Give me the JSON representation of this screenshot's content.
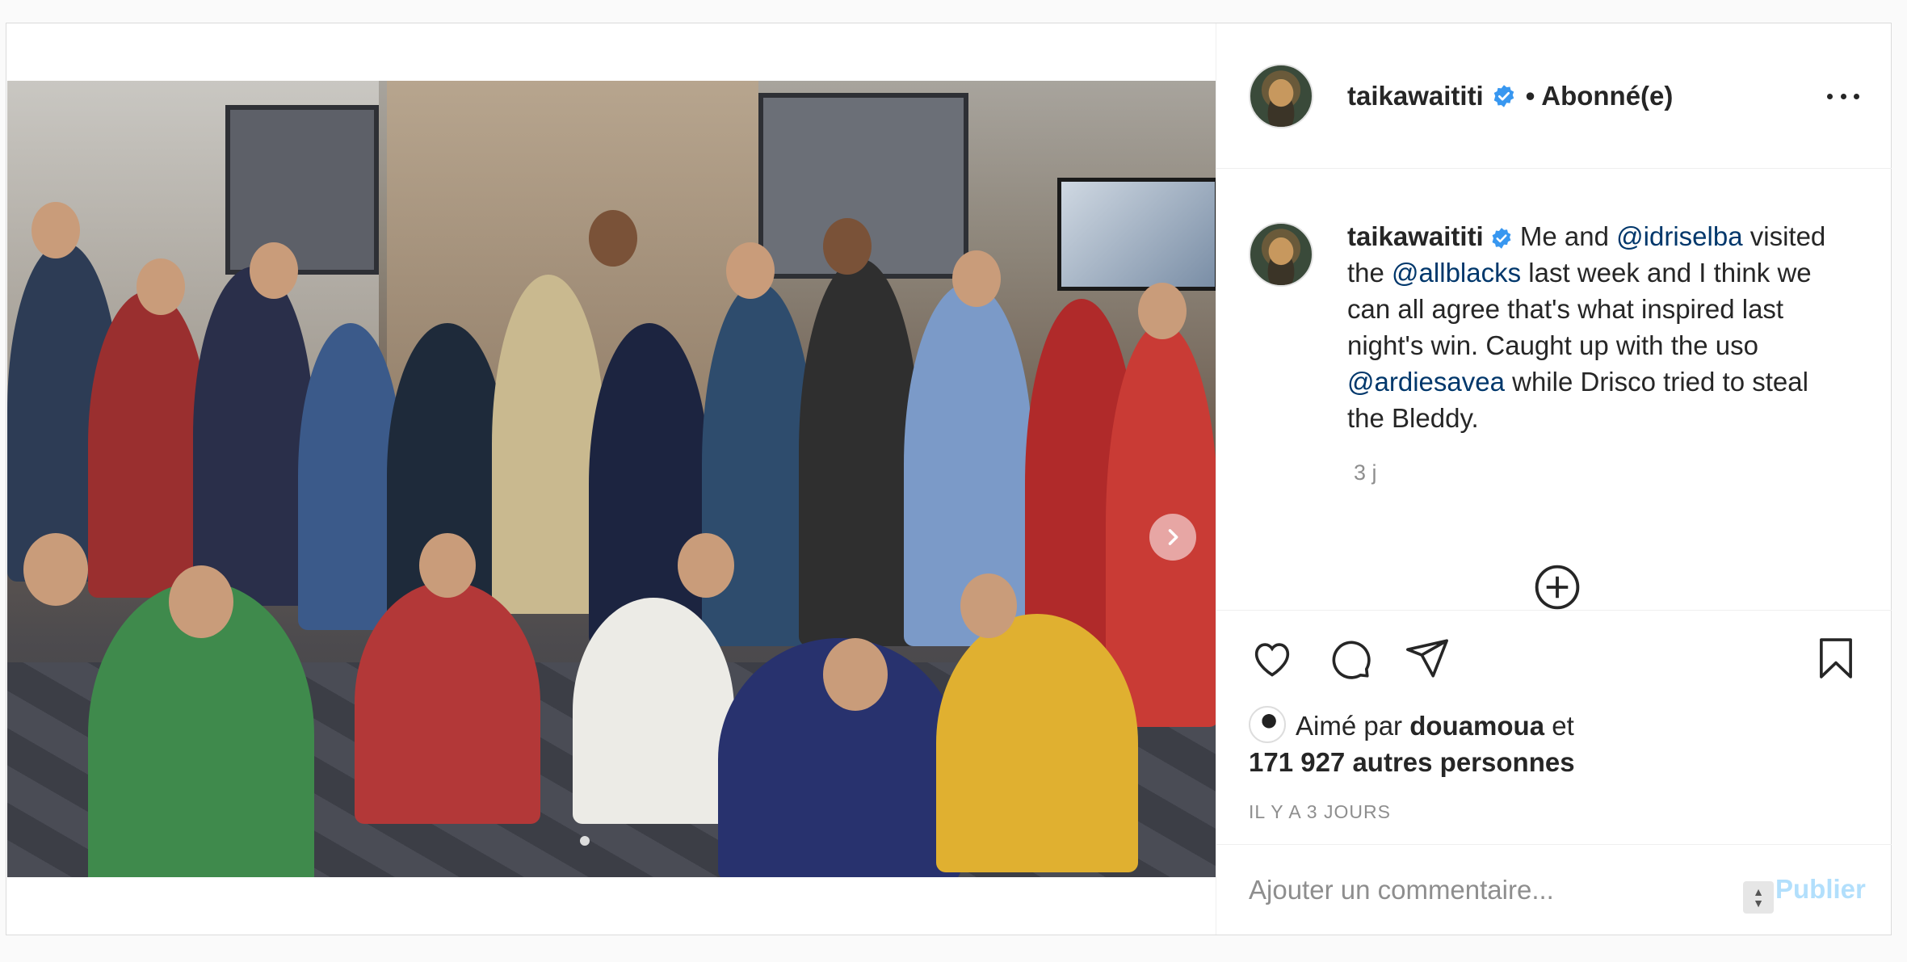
{
  "post": {
    "username": "taikawaititi",
    "follow_state": "• Abonné(e)",
    "caption": {
      "username": "taikawaititi",
      "part1": " Me and ",
      "mention1": "@idriselba",
      "part2": " visited the ",
      "mention2": "@allblacks",
      "part3": " last week and I think we can all agree that's what inspired last night's win. Caught up with the uso ",
      "mention3": "@ardiesavea",
      "part4": " while Drisco tried to steal the Bleddy."
    },
    "time_ago": "3 j",
    "likes_prefix": "Aimé par ",
    "liked_by": "douamoua",
    "likes_mid": " et",
    "likes_others": "171 927 autres personnes",
    "date": "IL Y A 3 JOURS",
    "comment_placeholder": "Ajouter un commentaire...",
    "publish_label": "Publier"
  },
  "icons": {
    "verified": "verified-badge-icon",
    "more": "more-options-icon",
    "like": "heart-icon",
    "comment": "comment-icon",
    "share": "send-icon",
    "save": "bookmark-icon",
    "next": "chevron-right-icon",
    "load_more": "plus-circle-icon"
  },
  "colors": {
    "mention": "#00376b",
    "verified": "#3897f0",
    "publish_disabled": "#b2dffc",
    "muted": "#8e8e8e"
  }
}
